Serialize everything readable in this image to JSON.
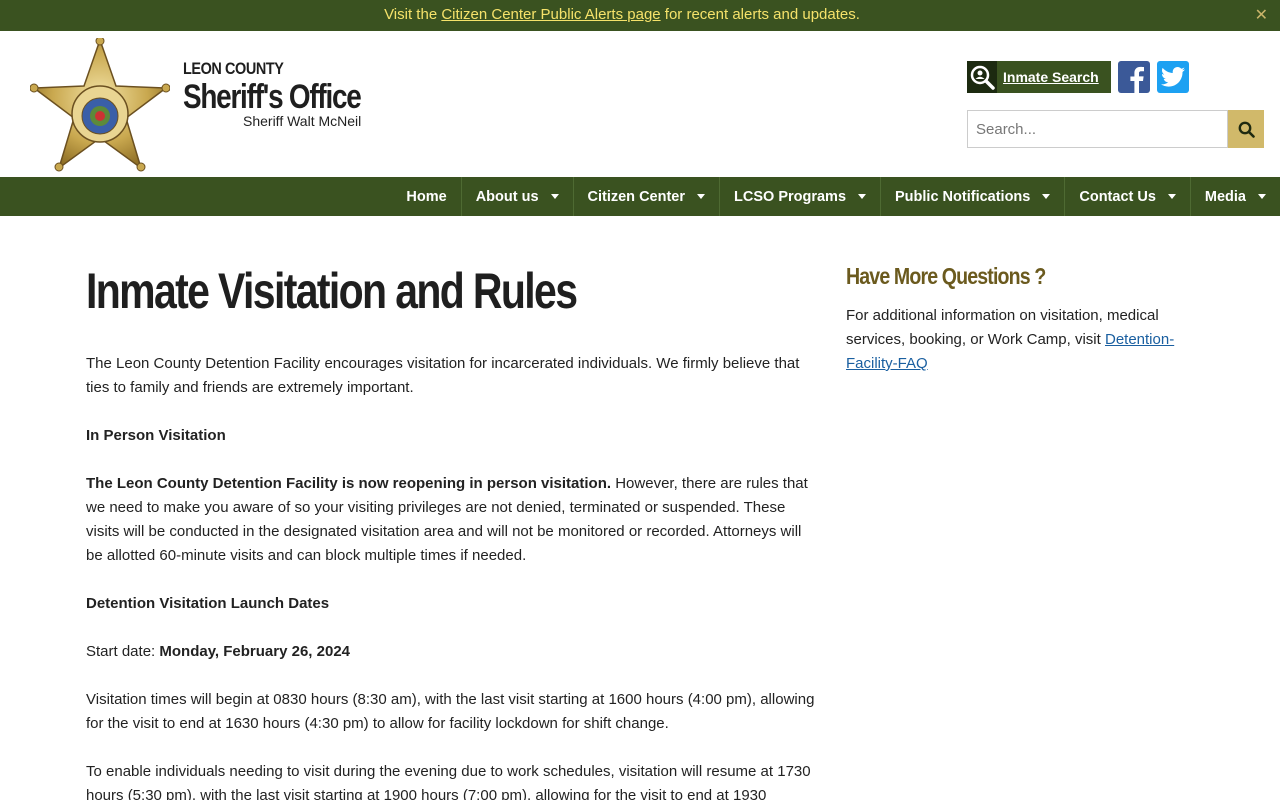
{
  "alert": {
    "prefix": "Visit the ",
    "link": "Citizen Center Public Alerts page",
    "suffix": " for recent alerts and updates.",
    "close": "✕"
  },
  "header": {
    "county": "LEON COUNTY",
    "office": "Sheriff's Office",
    "sheriff": "Sheriff Walt McNeil",
    "inmate_search": "Inmate Search",
    "search_placeholder": "Search..."
  },
  "nav": {
    "items": [
      {
        "label": "Home",
        "dropdown": false
      },
      {
        "label": "About us",
        "dropdown": true
      },
      {
        "label": "Citizen Center",
        "dropdown": true
      },
      {
        "label": "LCSO Programs",
        "dropdown": true
      },
      {
        "label": "Public Notifications",
        "dropdown": true
      },
      {
        "label": "Contact Us",
        "dropdown": true
      },
      {
        "label": "Media",
        "dropdown": true
      }
    ]
  },
  "main": {
    "title": "Inmate Visitation and Rules",
    "intro": "The Leon County Detention Facility encourages visitation for incarcerated individuals. We firmly believe that ties to family and friends are extremely important.",
    "in_person_heading": "In Person Visitation",
    "reopen_bold": "The Leon County Detention Facility is now reopening in person visitation.",
    "reopen_rest": " However, there are rules that we need to make you aware of so your visiting privileges are not denied, terminated or suspended. These visits will be conducted in the designated visitation area and will not be monitored or recorded. Attorneys will be allotted 60-minute visits and can block multiple times if needed.",
    "launch_heading": "Detention Visitation Launch Dates",
    "start_label": "Start date: ",
    "start_date": "Monday, February 26, 2024",
    "times": "Visitation times will begin at 0830 hours (8:30 am), with the last visit starting at 1600 hours (4:00 pm), allowing for the visit to end at 1630 hours (4:30 pm) to allow for facility lockdown for shift change.",
    "evening": "To enable individuals needing to visit during the evening due to work schedules, visitation will resume at 1730 hours (5:30 pm), with the last visit starting at 1900 hours (7:00 pm), allowing for the visit to end at 1930"
  },
  "sidebar": {
    "title": "Have More Questions ?",
    "text": "For additional information on visitation, medical services, booking, or Work Camp, visit ",
    "link": "Detention-Facility-FAQ"
  },
  "colors": {
    "brand_green": "#3a5220",
    "alert_text": "#f5e26a",
    "gold": "#d1b96a",
    "sidebar_title": "#6b5a1e"
  }
}
